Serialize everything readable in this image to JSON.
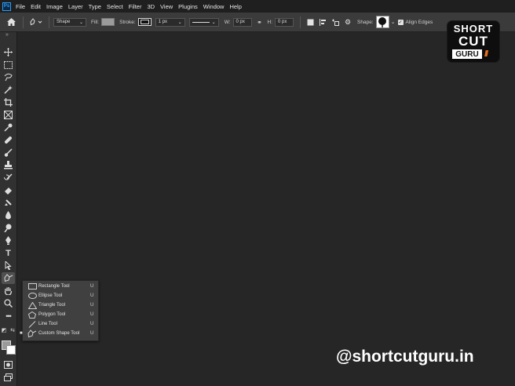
{
  "app": {
    "logo": "Ps"
  },
  "menu": [
    "File",
    "Edit",
    "Image",
    "Layer",
    "Type",
    "Select",
    "Filter",
    "3D",
    "View",
    "Plugins",
    "Window",
    "Help"
  ],
  "options": {
    "mode": "Shape",
    "fill_label": "Fill:",
    "fill_color": "#9b9b9b",
    "stroke_label": "Stroke:",
    "stroke_width": "1 px",
    "w_label": "W:",
    "w_value": "0 px",
    "h_label": "H:",
    "h_value": "0 px",
    "shape_label": "Shape:",
    "align_edges_label": "Align Edges",
    "align_edges_checked": true
  },
  "tools": [
    "move-tool",
    "marquee-tool",
    "lasso-tool",
    "quick-selection-tool",
    "crop-tool",
    "frame-tool",
    "eyedropper-tool",
    "spot-healing-tool",
    "brush-tool",
    "clone-stamp-tool",
    "history-brush-tool",
    "eraser-tool",
    "gradient-tool",
    "blur-tool",
    "dodge-tool",
    "pen-tool",
    "type-tool",
    "path-selection-tool",
    "custom-shape-tool",
    "hand-tool",
    "zoom-tool",
    "more-tools"
  ],
  "flyout": [
    {
      "label": "Rectangle Tool",
      "key": "U",
      "icon": "rectangle-icon"
    },
    {
      "label": "Ellipse Tool",
      "key": "U",
      "icon": "ellipse-icon"
    },
    {
      "label": "Triangle Tool",
      "key": "U",
      "icon": "triangle-icon"
    },
    {
      "label": "Polygon Tool",
      "key": "U",
      "icon": "polygon-icon"
    },
    {
      "label": "Line Tool",
      "key": "U",
      "icon": "line-icon"
    },
    {
      "label": "Custom Shape Tool",
      "key": "U",
      "icon": "custom-shape-icon",
      "selected": true
    }
  ],
  "watermark": {
    "line1": "SHORT",
    "line2": "CUT",
    "line3": "GURU",
    "handle": "@shortcutguru.in"
  },
  "colors": {
    "foreground": "#9a9a9a",
    "background": "#ffffff",
    "accent_orange": "#e8711c"
  }
}
